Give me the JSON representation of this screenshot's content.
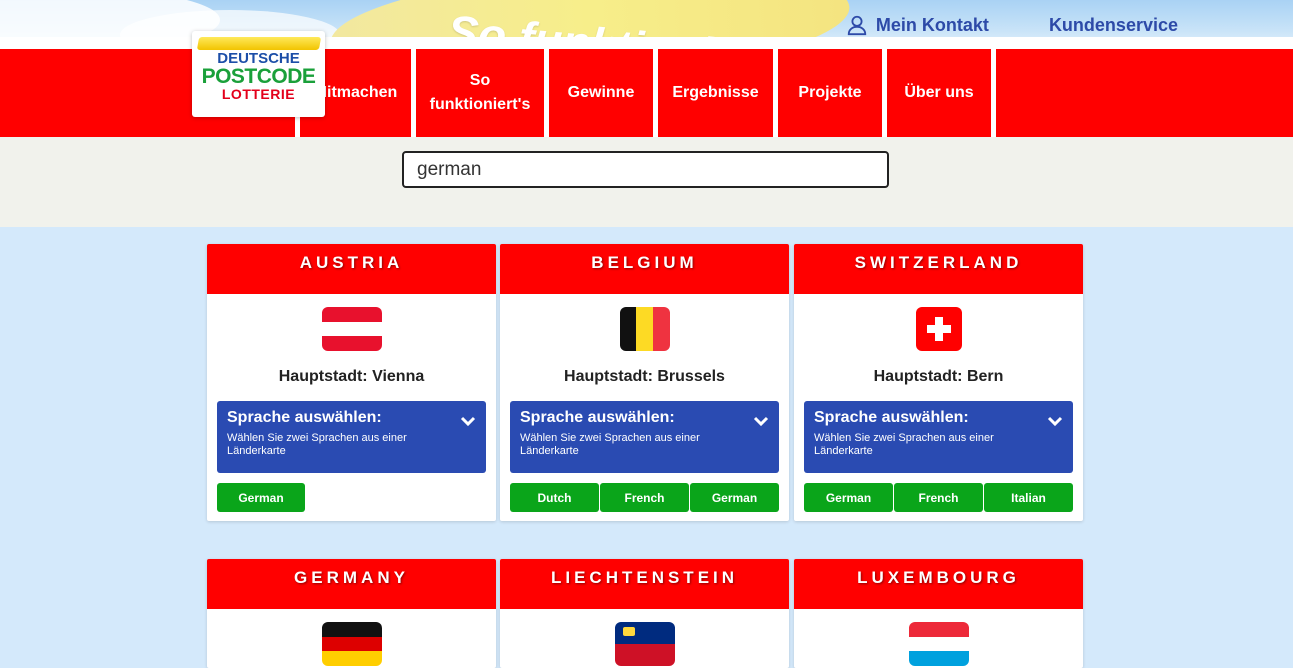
{
  "header": {
    "hero_text": "So funktioniert's",
    "top_links": [
      {
        "label": "Mein Kontakt",
        "icon": "user-icon"
      },
      {
        "label": "Kundenservice"
      }
    ]
  },
  "logo": {
    "line1": "DEUTSCHE",
    "line2": "POSTCODE",
    "line3": "LOTTERIE"
  },
  "nav": {
    "items": [
      {
        "label": "Mitmachen"
      },
      {
        "label": "So funktioniert's"
      },
      {
        "label": "Gewinne"
      },
      {
        "label": "Ergebnisse"
      },
      {
        "label": "Projekte"
      },
      {
        "label": "Über uns"
      }
    ]
  },
  "search": {
    "value": "german",
    "placeholder": ""
  },
  "countries": [
    {
      "name": "AUSTRIA",
      "capital": "Hauptstadt: Vienna",
      "flag": "flag-austria-icon",
      "select_title": "Sprache auswählen:",
      "select_sub": "Wählen Sie zwei Sprachen aus einer Länderkarte",
      "languages": [
        "German"
      ]
    },
    {
      "name": "BELGIUM",
      "capital": "Hauptstadt: Brussels",
      "flag": "flag-belgium-icon",
      "select_title": "Sprache auswählen:",
      "select_sub": "Wählen Sie zwei Sprachen aus einer Länderkarte",
      "languages": [
        "Dutch",
        "French",
        "German"
      ]
    },
    {
      "name": "SWITZERLAND",
      "capital": "Hauptstadt: Bern",
      "flag": "flag-switzerland-icon",
      "select_title": "Sprache auswählen:",
      "select_sub": "Wählen Sie zwei Sprachen aus einer Länderkarte",
      "languages": [
        "German",
        "French",
        "Italian"
      ]
    },
    {
      "name": "GERMANY",
      "flag": "flag-germany-icon"
    },
    {
      "name": "LIECHTENSTEIN",
      "flag": "flag-liechtenstein-icon"
    },
    {
      "name": "LUXEMBOURG",
      "flag": "flag-luxembourg-icon"
    }
  ],
  "colors": {
    "nav_red": "#ff0000",
    "link_blue": "#2d4aa8",
    "select_blue": "#2a4bb2",
    "button_green": "#0aa51a"
  }
}
